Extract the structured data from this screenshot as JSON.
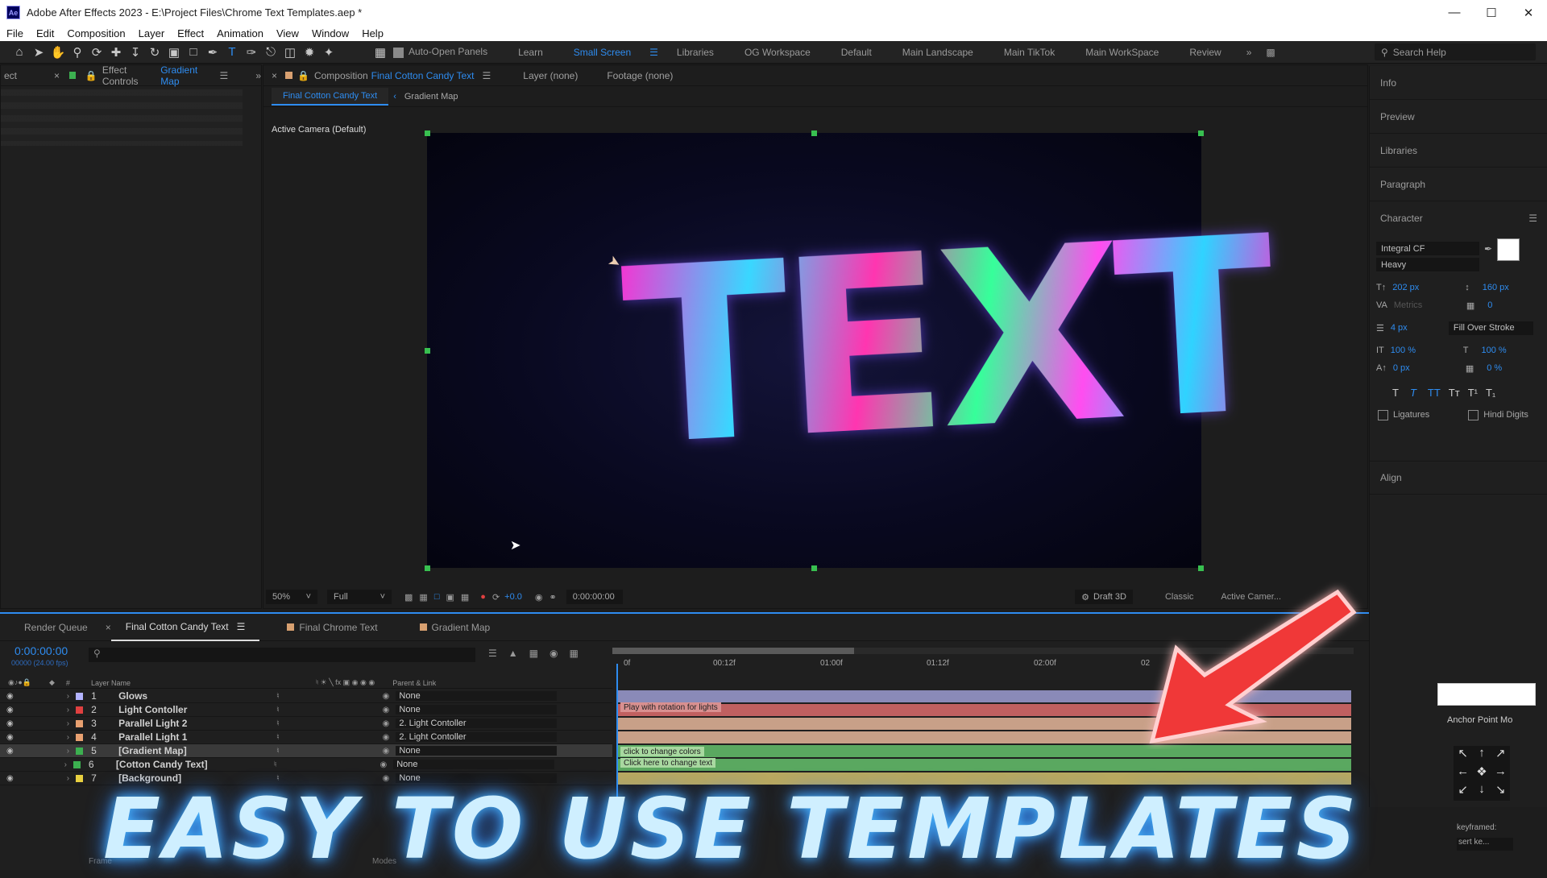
{
  "window": {
    "title": "Adobe After Effects 2023 - E:\\Project Files\\Chrome Text Templates.aep *",
    "logo": "Ae"
  },
  "menu": [
    "File",
    "Edit",
    "Composition",
    "Layer",
    "Effect",
    "Animation",
    "View",
    "Window",
    "Help"
  ],
  "toolbar": {
    "auto_open": "Auto-Open Panels",
    "workspaces": [
      "Learn",
      "Small Screen",
      "Libraries",
      "OG Workspace",
      "Default",
      "Main Landscape",
      "Main TikTok",
      "Main WorkSpace",
      "Review"
    ],
    "active_workspace": "Small Screen",
    "search_placeholder": "Search Help"
  },
  "effect_panel": {
    "prefix": "ect",
    "title": "Effect Controls",
    "target": "Gradient Map"
  },
  "comp_panel": {
    "title": "Composition",
    "name": "Final Cotton Candy Text",
    "layer": "Layer (none)",
    "footage": "Footage (none)",
    "breadcrumbs": [
      "Final Cotton Candy Text",
      "Gradient Map"
    ],
    "camera": "Active Camera (Default)",
    "preview_text": "TEXT"
  },
  "viewer_bar": {
    "zoom": "50%",
    "resolution": "Full",
    "exposure": "+0.0",
    "timecode": "0:00:00:00",
    "draft": "Draft 3D",
    "renderer": "Classic",
    "camera": "Active Camer..."
  },
  "right_panel": {
    "items": [
      "Info",
      "Preview",
      "Libraries",
      "Paragraph"
    ],
    "character": {
      "title": "Character",
      "font": "Integral CF",
      "style": "Heavy",
      "size": "202 px",
      "leading": "160 px",
      "kerning": "Metrics",
      "tracking": "0",
      "stroke": "4 px",
      "stroke_mode": "Fill Over Stroke",
      "vscale": "100 %",
      "hscale": "100 %",
      "baseline": "0 px",
      "tsume": "0 %",
      "styles": [
        "T",
        "T",
        "TT",
        "Tт",
        "T¹",
        "T₁"
      ],
      "ligatures": "Ligatures",
      "hindi": "Hindi Digits"
    },
    "align": "Align"
  },
  "anchor_panel": {
    "title": "Anchor Point Mo",
    "keyframed": "keyframed:",
    "insert": "sert ke..."
  },
  "timeline": {
    "tabs": [
      "Render Queue",
      "Final Cotton Candy Text",
      "Final Chrome Text",
      "Gradient Map"
    ],
    "timecode": "0:00:00:00",
    "fps": "00000 (24.00 fps)",
    "col_layer": "Layer Name",
    "col_parent": "Parent & Link",
    "ruler": [
      "0f",
      "00:12f",
      "01:00f",
      "01:12f",
      "02:00f",
      "02"
    ],
    "layers": [
      {
        "num": "1",
        "name": "Glows",
        "parent": "None",
        "color": "#b3b3ff"
      },
      {
        "num": "2",
        "name": "Light Contoller",
        "parent": "None",
        "color": "#e04040"
      },
      {
        "num": "3",
        "name": "Parallel Light 2",
        "parent": "2. Light Contoller",
        "color": "#e8a070"
      },
      {
        "num": "4",
        "name": "Parallel Light 1",
        "parent": "2. Light Contoller",
        "color": "#e8a070"
      },
      {
        "num": "5",
        "name": "[Gradient Map]",
        "parent": "None",
        "color": "#3cb050"
      },
      {
        "num": "6",
        "name": "[Cotton Candy Text]",
        "parent": "None",
        "color": "#3cb050"
      },
      {
        "num": "7",
        "name": "[Background]",
        "parent": "None",
        "color": "#e8d040"
      }
    ],
    "bar_labels": [
      "Play with rotation for lights",
      "click to change colors",
      "Click here to change text"
    ],
    "footer": [
      "Frame",
      "Modes"
    ]
  },
  "overlay": {
    "banner": "EASY TO USE TEMPLATES"
  }
}
